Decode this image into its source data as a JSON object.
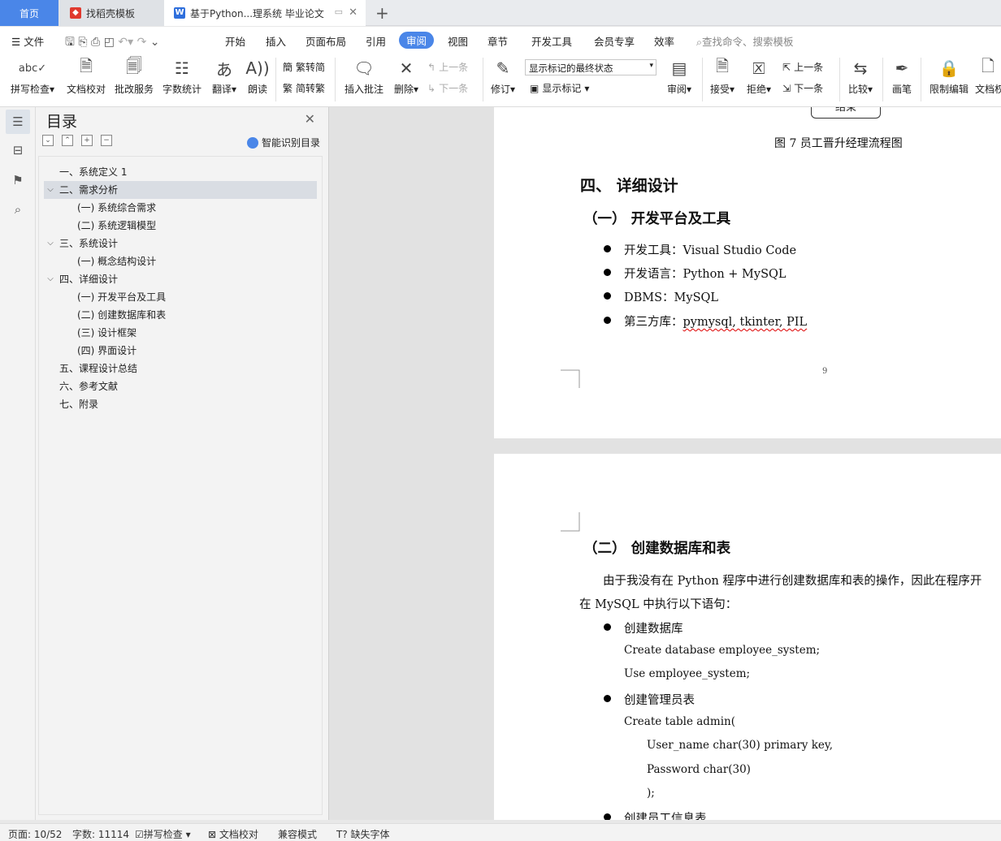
{
  "tabs": {
    "home": "首页",
    "tab2": "找稻壳模板",
    "tab3": "基于Python...理系统 毕业论文"
  },
  "menu": {
    "file": "文件",
    "items": [
      "开始",
      "插入",
      "页面布局",
      "引用",
      "审阅",
      "视图",
      "章节",
      "开发工具",
      "会员专享",
      "效率"
    ],
    "active": "审阅",
    "search": "查找命令、搜索模板"
  },
  "ribbon": {
    "spell": "拼写检查",
    "proof": "文档校对",
    "annotate_service": "批改服务",
    "wordcount": "字数统计",
    "translate": "翻译",
    "read": "朗读",
    "trad_to_simp": "繁转简",
    "simp_to_trad": "简转繁",
    "insert_comment": "插入批注",
    "delete": "删除",
    "prev_comment": "上一条",
    "next_comment": "下一条",
    "revise": "修订",
    "markup_state": "显示标记的最终状态",
    "show_markup": "显示标记",
    "review": "审阅",
    "accept": "接受",
    "reject": "拒绝",
    "prev_change": "上一条",
    "next_change": "下一条",
    "compare": "比较",
    "pen": "画笔",
    "restrict": "限制编辑",
    "doc_rights": "文档权"
  },
  "toc": {
    "title": "目录",
    "smart": "智能识别目录",
    "items": [
      {
        "text": "一、系统定义 1",
        "level": 1,
        "chevron": false
      },
      {
        "text": "二、需求分析",
        "level": 1,
        "chevron": true,
        "selected": true
      },
      {
        "text": "(一) 系统综合需求",
        "level": 2,
        "chevron": false
      },
      {
        "text": "(二) 系统逻辑模型",
        "level": 2,
        "chevron": false
      },
      {
        "text": "三、系统设计",
        "level": 1,
        "chevron": true
      },
      {
        "text": "(一) 概念结构设计",
        "level": 2,
        "chevron": false
      },
      {
        "text": "四、详细设计",
        "level": 1,
        "chevron": true
      },
      {
        "text": "(一) 开发平台及工具",
        "level": 2,
        "chevron": false
      },
      {
        "text": "(二) 创建数据库和表",
        "level": 2,
        "chevron": false
      },
      {
        "text": "(三) 设计框架",
        "level": 2,
        "chevron": false
      },
      {
        "text": "(四) 界面设计",
        "level": 2,
        "chevron": false
      },
      {
        "text": "五、课程设计总结",
        "level": 1,
        "chevron": false
      },
      {
        "text": "六、参考文献",
        "level": 1,
        "chevron": false
      },
      {
        "text": "七、附录",
        "level": 1,
        "chevron": false
      }
    ]
  },
  "doc": {
    "end_box": "结束",
    "fig_caption": "图 7 员工晋升经理流程图",
    "h_detail": "四、 详细设计",
    "h_platform": "（一）   开发平台及工具",
    "b1": "开发工具：Visual Studio Code",
    "b2": "开发语言：Python + MySQL",
    "b3": "DBMS：MySQL",
    "b4_prefix": "第三方库：",
    "b4_libs": "pymysql, tkinter, PIL",
    "page_num": "9",
    "h_db": "（二）   创建数据库和表",
    "para1": "由于我没有在 Python 程序中进行创建数据库和表的操作，因此在程序开",
    "para2": "在 MySQL 中执行以下语句：",
    "c1": "创建数据库",
    "code1": "Create database employee_system;",
    "code2": "Use employee_system;",
    "c2": "创建管理员表",
    "code3": "Create table admin(",
    "code4": "User_name char(30) primary key,",
    "code5": "Password char(30)",
    "code6": ");",
    "c3": "创建员工信息表"
  },
  "status": {
    "page": "页面: 10/52",
    "words": "字数: 11114",
    "spell": "拼写检查",
    "proof": "文档校对",
    "compat": "兼容模式",
    "missing_font": "缺失字体"
  },
  "colors": {
    "accent": "#4a86e8"
  }
}
